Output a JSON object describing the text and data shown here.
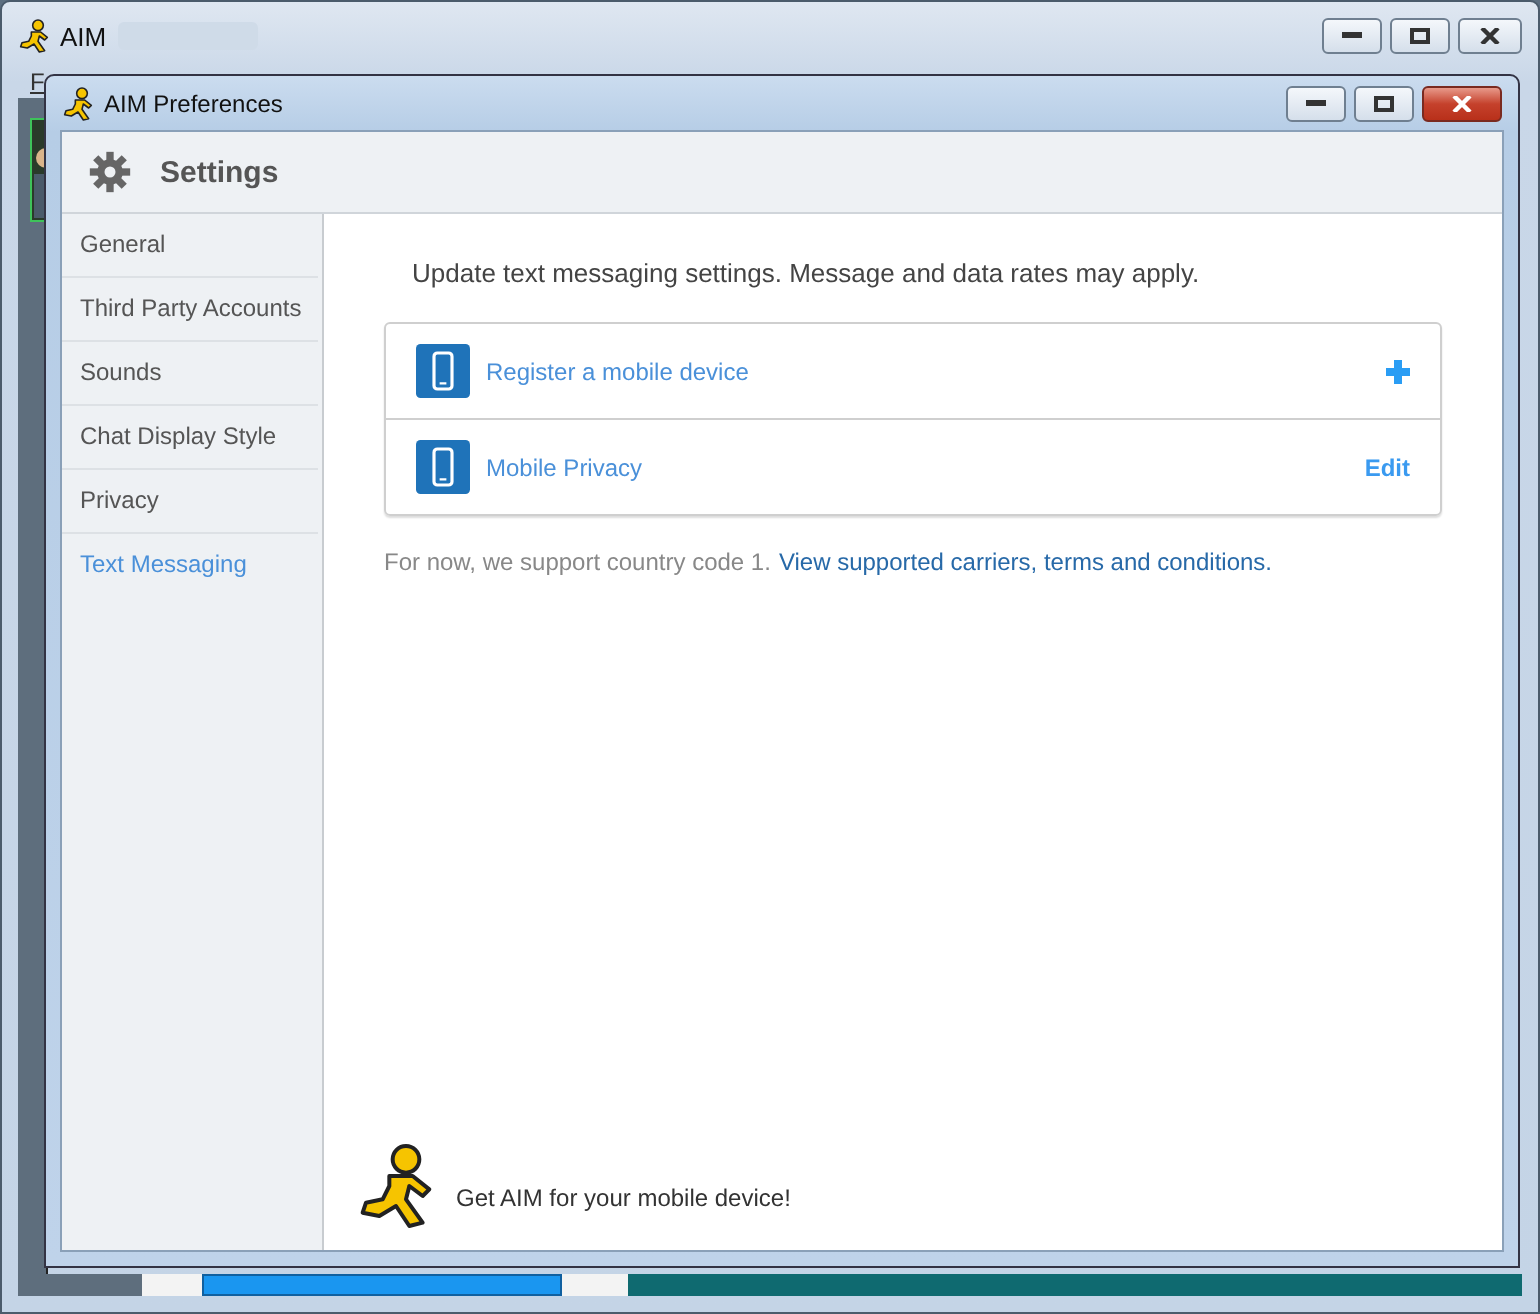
{
  "back_window": {
    "title": "AIM",
    "menu": [
      "F"
    ]
  },
  "window": {
    "title": "AIM Preferences"
  },
  "header": {
    "title": "Settings"
  },
  "sidebar": {
    "items": [
      {
        "label": "General",
        "selected": false
      },
      {
        "label": "Third Party Accounts",
        "selected": false
      },
      {
        "label": "Sounds",
        "selected": false
      },
      {
        "label": "Chat Display Style",
        "selected": false
      },
      {
        "label": "Privacy",
        "selected": false
      },
      {
        "label": "Text Messaging",
        "selected": true
      }
    ]
  },
  "intro": "Update text messaging settings. Message and data rates may apply.",
  "options": [
    {
      "label": "Register a mobile device",
      "action": {
        "kind": "add"
      }
    },
    {
      "label": "Mobile Privacy",
      "action": {
        "kind": "text",
        "text": "Edit"
      }
    }
  ],
  "note": {
    "text": "For now, we support country code 1.",
    "link": "View supported carriers, terms and conditions."
  },
  "promo": "Get AIM for your mobile device!"
}
